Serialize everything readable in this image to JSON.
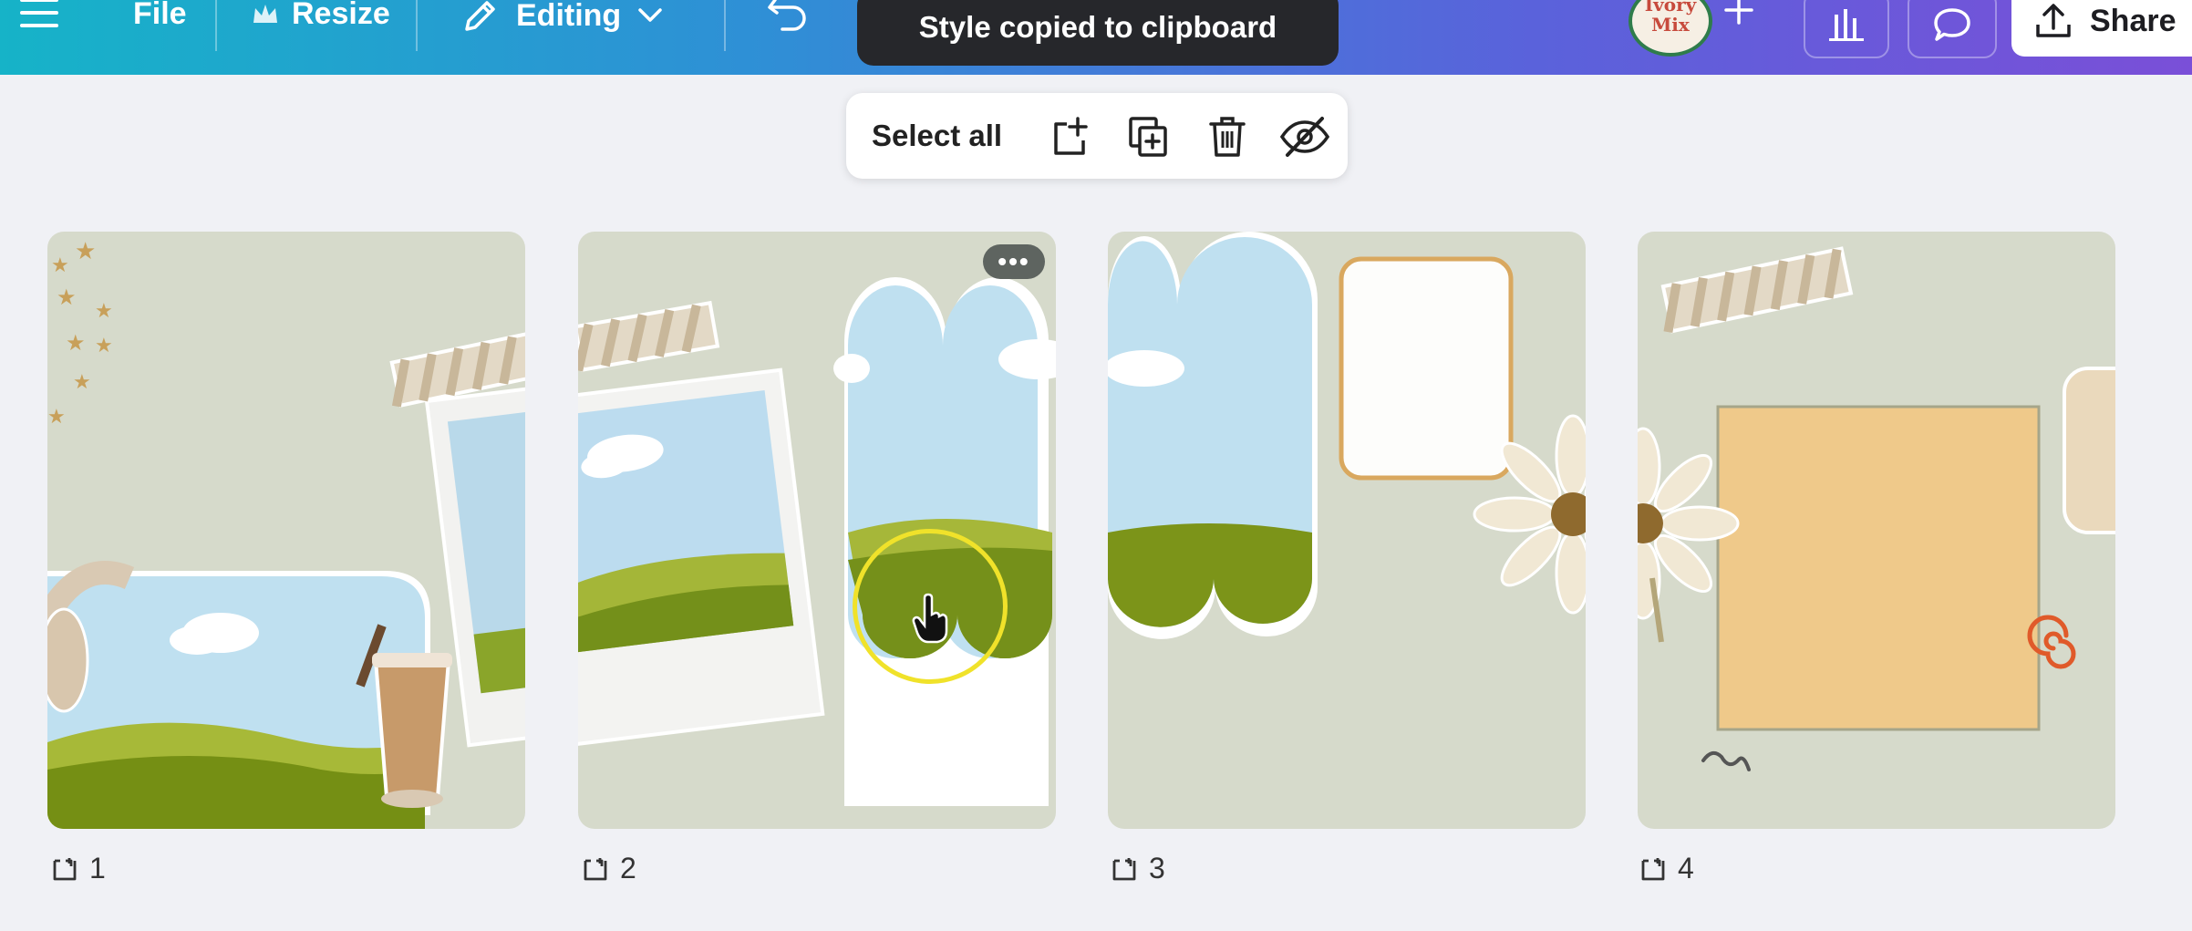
{
  "topbar": {
    "menu_icon": "hamburger-icon",
    "file_label": "File",
    "resize_label": "Resize",
    "editing_label": "Editing",
    "share_label": "Share",
    "avatar_text_line1": "Ivory",
    "avatar_text_line2": "Mix"
  },
  "toast": {
    "text": "Style copied to clipboard"
  },
  "selection_toolbar": {
    "select_all_label": "Select all",
    "icons": [
      "add-page-icon",
      "duplicate-page-icon",
      "delete-icon",
      "hide-icon"
    ]
  },
  "pages": [
    {
      "number": "1"
    },
    {
      "number": "2"
    },
    {
      "number": "3"
    },
    {
      "number": "4"
    }
  ],
  "page_more_label": "•••",
  "colors": {
    "topbar_start": "#16b3c8",
    "topbar_end": "#7a4fd8",
    "page_background": "#d6dacb",
    "grass": "#7a9418",
    "sky": "#bcdcef",
    "note_paper": "#efcb8c"
  }
}
